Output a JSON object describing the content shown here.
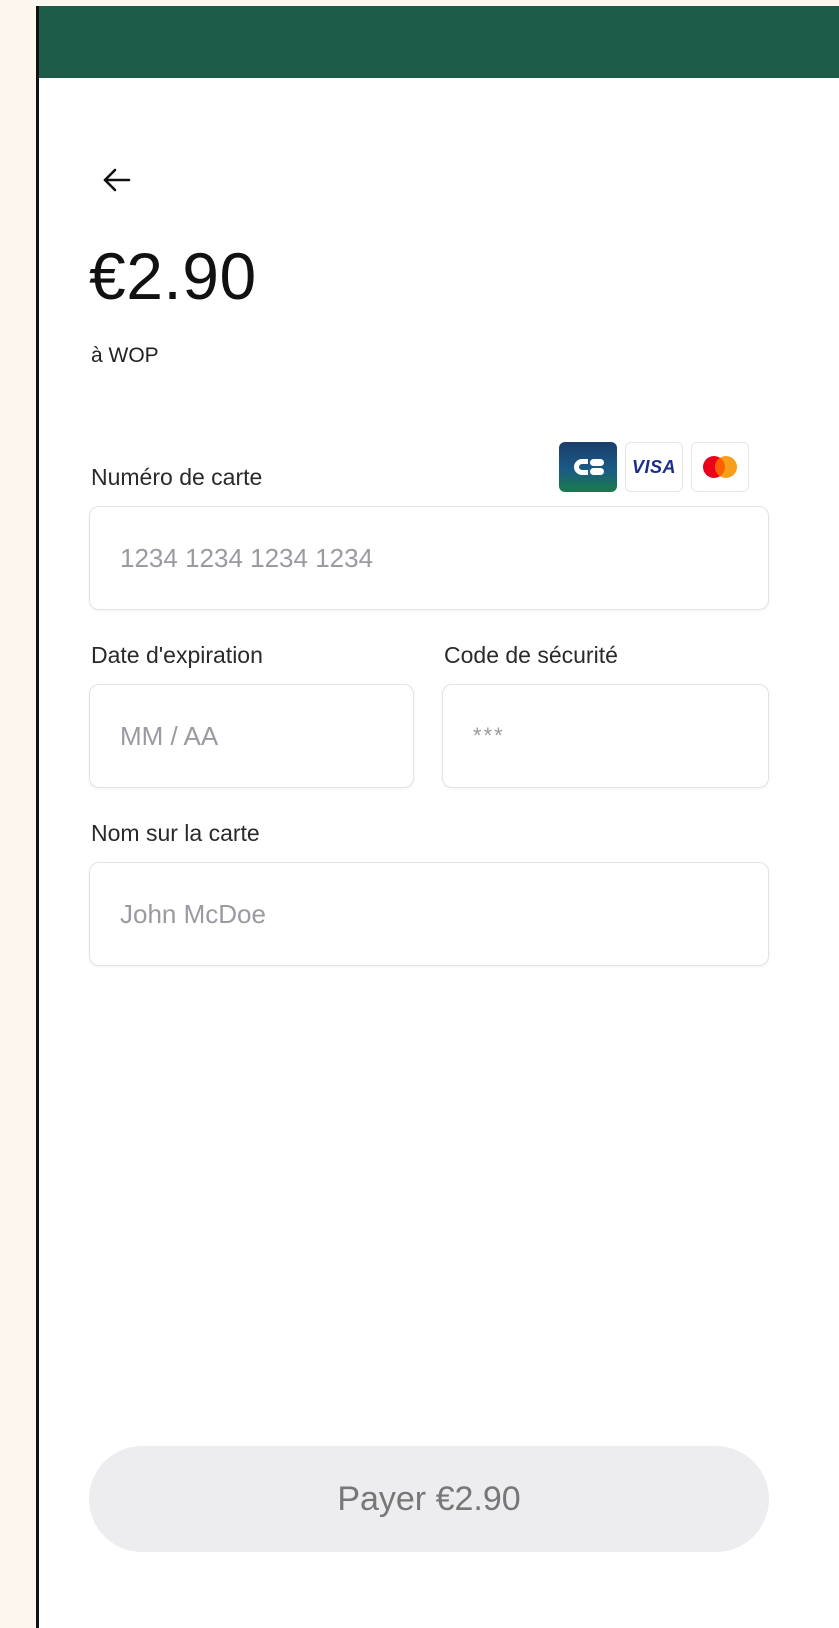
{
  "header": {
    "back_icon": "arrow-left-icon"
  },
  "payment": {
    "amount": "€2.90",
    "merchant": "à WOP"
  },
  "form": {
    "card_number": {
      "label": "Numéro de carte",
      "placeholder": "1234 1234 1234 1234",
      "value": ""
    },
    "expiry": {
      "label": "Date d'expiration",
      "placeholder": "MM / AA",
      "value": ""
    },
    "cvc": {
      "label": "Code de sécurité",
      "placeholder": "***",
      "value": ""
    },
    "name": {
      "label": "Nom sur la carte",
      "placeholder": "John McDoe",
      "value": ""
    }
  },
  "card_brands": [
    {
      "name": "CB",
      "label": "CB"
    },
    {
      "name": "Visa",
      "label": "VISA"
    },
    {
      "name": "Mastercard"
    }
  ],
  "pay_button": {
    "label": "Payer €2.90"
  },
  "colors": {
    "header": "#1c5c48",
    "button_bg": "#ededf0",
    "button_text": "#777777"
  }
}
